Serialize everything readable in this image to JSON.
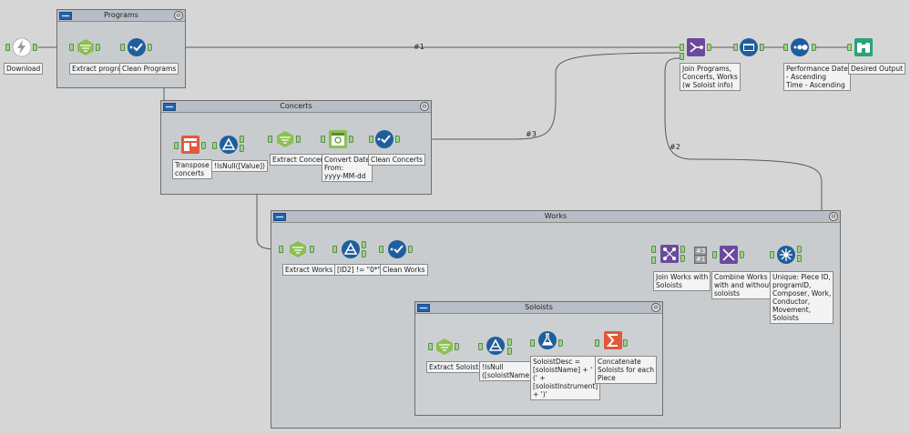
{
  "containers": {
    "programs": "Programs",
    "concerts": "Concerts",
    "works": "Works",
    "soloists": "Soloists",
    "collapse_glyph": "⊖"
  },
  "tools": {
    "download": "Download",
    "extract_programs": "Extract programs",
    "clean_programs": "Clean Programs",
    "join_programs": "Join Programs,\nConcerts, Works\n(w Soloist info)",
    "sort": "Performance Date\n- Ascending\nTime - Ascending",
    "desired_output": "Desired Output",
    "transpose_concerts": "Transpose\nconcerts",
    "isnull_value": "!IsNull([Value])",
    "extract_concerts": "Extract Concerts",
    "convert_date": "Convert Date\nFrom:\nyyyy-MM-dd",
    "clean_concerts": "Clean Concerts",
    "extract_works": "Extract Works",
    "filter_id2": "[ID2] != \"0*\"",
    "clean_works": "Clean Works",
    "join_works_soloists": "Join Works with\nSoloists",
    "combine_works": "Combine Works\nwith and without\nsoloists",
    "unique": "Unique: Piece ID,\nprogramID,\nComposer, Work,\nConductor,\nMovement,\nSoloists",
    "extract_soloists": "Extract Soloists",
    "isnull_soloist": "!IsNull\n([soloistName])",
    "soloist_desc": "SoloistDesc =\n[soloistName] + '\n(' +\n[soloistInstrument]\n+ ')'",
    "concatenate": "Concatenate\nSoloists for each\nPiece"
  },
  "wire_labels": {
    "w1": "#1",
    "w2": "#2",
    "w3": "#3",
    "b3": "#3",
    "b1": "#1"
  },
  "colors": {
    "wire": "#5a5a5a",
    "parse_green": "#8cbf52",
    "prep_blue": "#1f5e9c",
    "transform_orange": "#e05a3a",
    "join_purple": "#6b4a9e",
    "output_teal": "#29a37a",
    "input_gray": "#9a9a9a"
  }
}
